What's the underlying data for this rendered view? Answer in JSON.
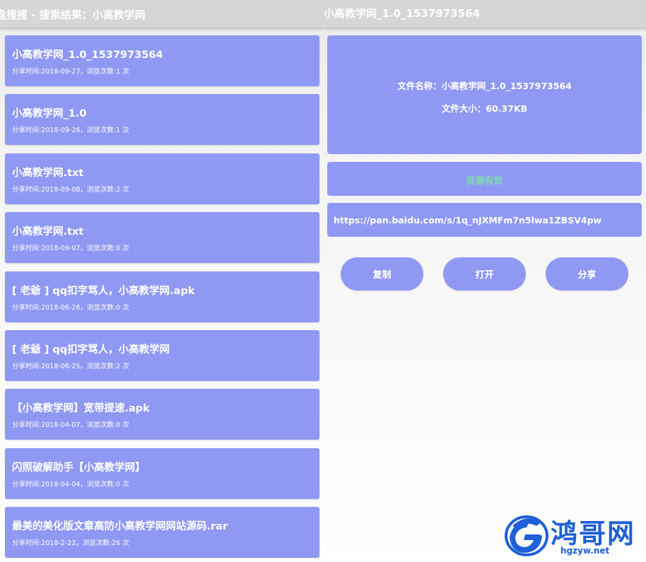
{
  "left": {
    "title": "盘搜搜 - 搜索结果：小高教学网",
    "results": [
      {
        "title": "小高教学网_1.0_1537973564",
        "meta": "分享时间:2018-09-27，浏览次数:1 次"
      },
      {
        "title": "小高教学网_1.0",
        "meta": "分享时间:2018-09-26，浏览次数:1 次"
      },
      {
        "title": "小高教学网.txt",
        "meta": "分享时间:2018-09-08，浏览次数:2 次"
      },
      {
        "title": "小高教学网.txt",
        "meta": "分享时间:2018-09-07，浏览次数:0 次"
      },
      {
        "title": "[ 老爺 ] qq扣字骂人，小高教学网.apk",
        "meta": "分享时间:2018-06-26，浏览次数:0 次"
      },
      {
        "title": "[ 老爺 ] qq扣字骂人，小高教学网",
        "meta": "分享时间:2018-06-25，浏览次数:2 次"
      },
      {
        "title": "【小高教学网】宽带提速.apk",
        "meta": "分享时间:2018-04-07，浏览次数:0 次"
      },
      {
        "title": "闪照破解助手【小高教学网】",
        "meta": "分享时间:2018-04-04，浏览次数:0 次"
      },
      {
        "title": "最美的美化版文章高防小高教学网网站源码.rar",
        "meta": "分享时间:2018-2-22，浏览次数:26 次"
      }
    ]
  },
  "right": {
    "title": "小高教学网_1.0_1537973564",
    "file_name_line": "文件名称：小高教学网_1.0_1537973564",
    "file_size_line": "文件大小：60.37KB",
    "status": "资源有效",
    "link": "https://pan.baidu.com/s/1q_nJXMFm7n5lwa1ZBSV4pw",
    "buttons": {
      "copy": "复制",
      "open": "打开",
      "share": "分享"
    }
  },
  "watermark": {
    "name": "鸿哥网",
    "url": "hgzyw.net"
  },
  "colors": {
    "card": "#8f99f4",
    "status": "#7ddda8",
    "watermark": "#1f5fd9"
  },
  "icons": {
    "watermark_logo": "hgzyw-logo-icon"
  }
}
